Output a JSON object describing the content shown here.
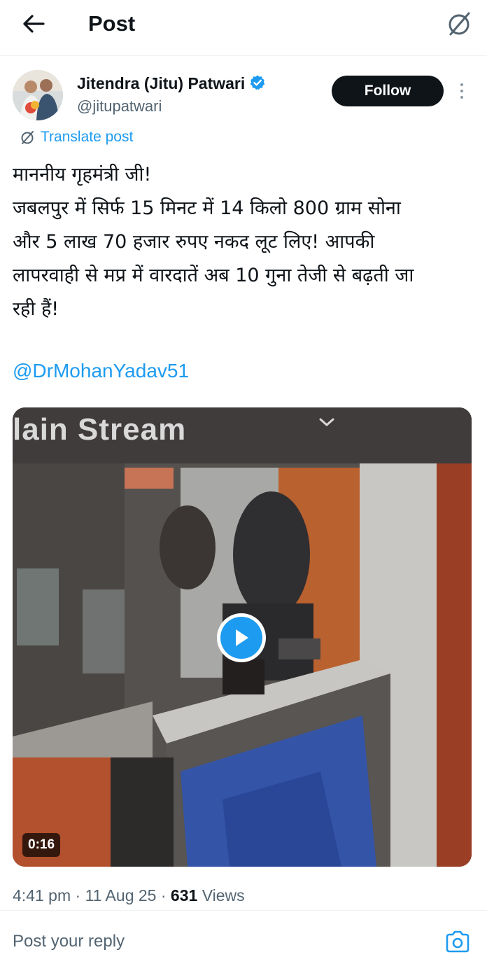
{
  "header": {
    "title": "Post",
    "back_icon": "arrow-left-icon",
    "grok_icon": "grok-slash-icon"
  },
  "author": {
    "name": "Jitendra (Jitu) Patwari",
    "handle": "@jitupatwari",
    "verified": true,
    "follow_label": "Follow"
  },
  "translate": {
    "label": "Translate post"
  },
  "post": {
    "lines": [
      "माननीय गृहमंत्री जी!",
      "जबलपुर में सिर्फ 15 मिनट में 14 किलो 800 ग्राम सोना",
      "और 5 लाख 70 हजार रुपए नकद लूट लिए! आपकी",
      "लापरवाही से मप्र में वारदातें अब 10 गुना तेजी से बढ़ती जा",
      "रही हैं!"
    ],
    "mention": "@DrMohanYadav51"
  },
  "media": {
    "overlay_text": "lain Stream",
    "duration": "0:16",
    "play_icon": "play-icon"
  },
  "meta": {
    "time": "4:41 pm",
    "date": "11 Aug 25",
    "views_count": "631",
    "views_label": "Views",
    "separator": "·"
  },
  "reply": {
    "placeholder": "Post your reply",
    "camera_icon": "camera-icon"
  },
  "colors": {
    "accent": "#1d9bf0",
    "text": "#0f1419",
    "secondary": "#536471"
  }
}
